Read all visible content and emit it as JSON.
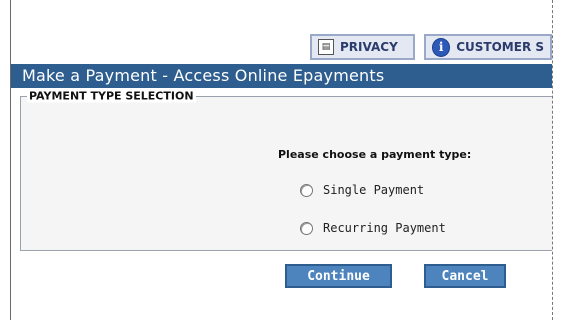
{
  "header": {
    "privacy_label": "PRIVACY",
    "customer_label": "CUSTOMER S"
  },
  "dialog": {
    "title": "Make a Payment - Access Online Epayments",
    "section_legend": "PAYMENT TYPE SELECTION",
    "prompt": "Please choose a payment type:",
    "options": [
      {
        "label": "Single Payment",
        "selected": false
      },
      {
        "label": "Recurring Payment",
        "selected": false
      }
    ],
    "continue_label": "Continue",
    "cancel_label": "Cancel"
  },
  "colors": {
    "title_bar": "#2e5e8f",
    "action_button": "#4d84bd",
    "header_button_bg": "#e3e8f3"
  },
  "icons": {
    "privacy": "document-icon",
    "customer": "info-icon"
  }
}
